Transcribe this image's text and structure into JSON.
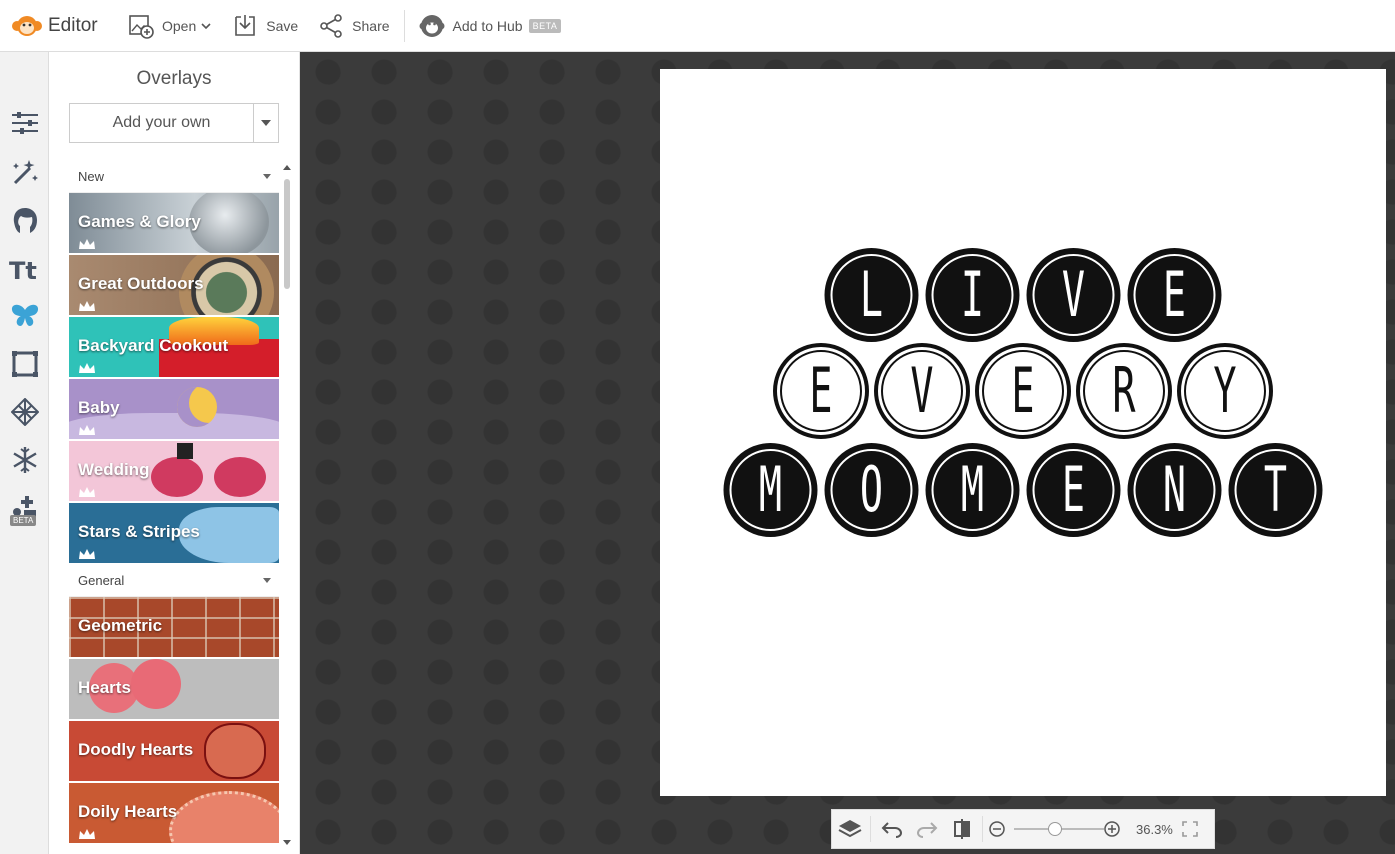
{
  "app": {
    "title": "Editor"
  },
  "toolbar": {
    "open_label": "Open",
    "save_label": "Save",
    "share_label": "Share",
    "hub_label": "Add to Hub",
    "hub_badge": "BETA"
  },
  "rail": {
    "items": [
      {
        "icon": "sliders-icon"
      },
      {
        "icon": "magic-wand-icon"
      },
      {
        "icon": "face-icon"
      },
      {
        "icon": "text-icon",
        "label": "Tt"
      },
      {
        "icon": "butterfly-icon",
        "active": true
      },
      {
        "icon": "frame-icon"
      },
      {
        "icon": "texture-icon"
      },
      {
        "icon": "snowflake-icon"
      },
      {
        "icon": "design-icon",
        "badge": "BETA"
      }
    ]
  },
  "panel": {
    "title": "Overlays",
    "add_own_label": "Add your own",
    "sections": [
      {
        "label": "New",
        "tiles": [
          {
            "name": "Games & Glory",
            "color": "#8e9aa3"
          },
          {
            "name": "Great Outdoors",
            "color": "#9c7b5e"
          },
          {
            "name": "Backyard Cookout",
            "color": "#2fc2b8"
          },
          {
            "name": "Baby",
            "color": "#a891c9"
          },
          {
            "name": "Wedding",
            "color": "#f0bfd3"
          },
          {
            "name": "Stars & Stripes",
            "color": "#2a6e96"
          }
        ]
      },
      {
        "label": "General",
        "tiles": [
          {
            "name": "Geometric",
            "color": "#b0502f"
          },
          {
            "name": "Hearts",
            "color": "#bdbdbd"
          },
          {
            "name": "Doodly Hearts",
            "color": "#c84a35"
          },
          {
            "name": "Doily Hearts",
            "color": "#c95a33"
          }
        ]
      }
    ]
  },
  "artwork": {
    "rows": [
      [
        "L",
        "I",
        "V",
        "E"
      ],
      [
        "E",
        "V",
        "E",
        "R",
        "Y"
      ],
      [
        "M",
        "O",
        "M",
        "E",
        "N",
        "T"
      ]
    ]
  },
  "zoom": {
    "value": "36.3%",
    "level": 0.45
  }
}
